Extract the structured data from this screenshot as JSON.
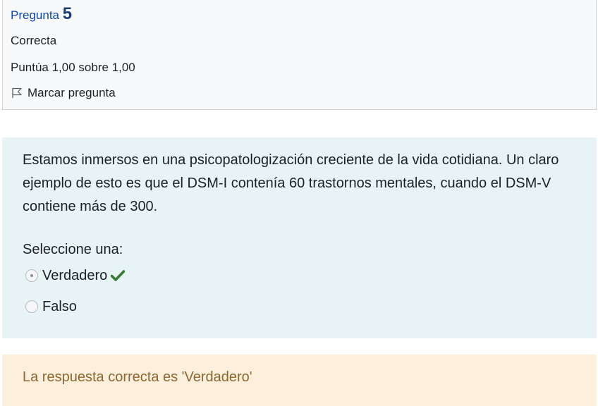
{
  "info": {
    "question_label": "Pregunta",
    "question_number": "5",
    "state": "Correcta",
    "grade": "Puntúa 1,00 sobre 1,00",
    "flag_label": "Marcar pregunta",
    "flag_icon": "flag-outline-icon"
  },
  "question": {
    "text": "Estamos inmersos en una psicopatologización creciente de la vida cotidiana. Un claro ejemplo de esto es que el DSM-I contenía 60 trastornos mentales, cuando el DSM-V contiene más de 300.",
    "prompt": "Seleccione una:",
    "options": [
      {
        "label": "Verdadero",
        "selected": true,
        "correct_icon": "checkmark-icon"
      },
      {
        "label": "Falso",
        "selected": false
      }
    ]
  },
  "feedback": {
    "text": "La respuesta correcta es 'Verdadero'"
  },
  "colors": {
    "title_blue": "#0f47ad",
    "content_bg": "#e7f3f5",
    "feedback_bg": "#fcefdc",
    "feedback_text": "#8e662e",
    "check_green": "#357a32"
  }
}
